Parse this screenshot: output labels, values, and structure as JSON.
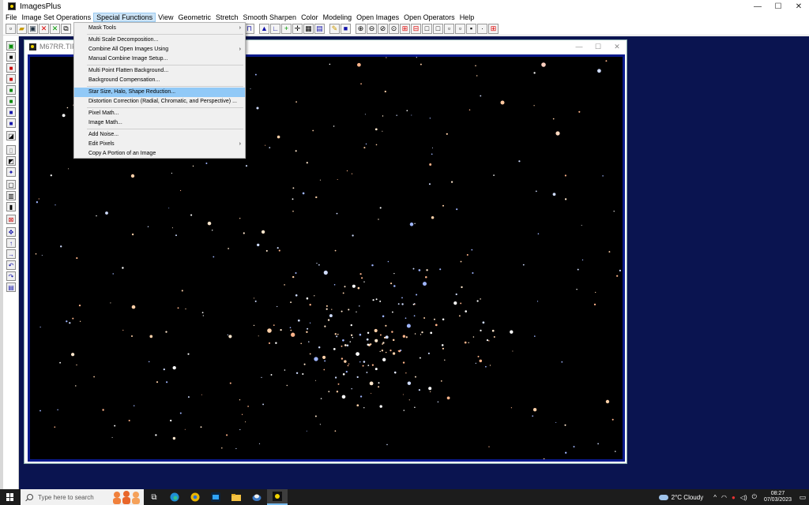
{
  "window": {
    "title": "ImagesPlus",
    "controls": {
      "minimize": "—",
      "maximize": "☐",
      "close": "✕"
    }
  },
  "menubar": {
    "items": [
      "File",
      "Image Set Operations",
      "Special Functions",
      "View",
      "Geometric",
      "Stretch",
      "Smooth Sharpen",
      "Color",
      "Modeling",
      "Open Images",
      "Open Operators",
      "Help"
    ],
    "active_index": 2
  },
  "dropdown": {
    "items": [
      {
        "label": "Mask Tools",
        "submenu": true
      },
      {
        "separator": true
      },
      {
        "label": "Multi Scale Decomposition...",
        "submenu": false
      },
      {
        "label": "Combine All Open Images Using",
        "submenu": true
      },
      {
        "label": "Manual Combine Image Setup...",
        "submenu": false
      },
      {
        "separator": true
      },
      {
        "label": "Multi Point Flatten Background...",
        "submenu": false
      },
      {
        "label": "Background Compensation...",
        "submenu": false
      },
      {
        "separator": true
      },
      {
        "label": "Star Size, Halo, Shape Reduction...",
        "submenu": false,
        "highlighted": true
      },
      {
        "label": "Distortion Correction (Radial, Chromatic, and Perspective) ...",
        "submenu": false
      },
      {
        "separator": true
      },
      {
        "label": "Pixel Math...",
        "submenu": false
      },
      {
        "label": "Image Math...",
        "submenu": false
      },
      {
        "separator": true
      },
      {
        "label": "Add Noise...",
        "submenu": false
      },
      {
        "label": "Edit Pixels",
        "submenu": true
      },
      {
        "label": "Copy A Portion of an Image",
        "submenu": false
      }
    ],
    "submenu_arrow": "›"
  },
  "image_window": {
    "title": "M67RR.TIF.tif -",
    "controls": {
      "minimize": "—",
      "maximize": "☐",
      "close": "✕"
    },
    "background": "#000000",
    "frame_color": "#0a1a8c"
  },
  "toolbar": {
    "icons": [
      "new-file-icon",
      "open-folder-icon",
      "save-icon",
      "close-red-x-icon",
      "accept-green-x-icon",
      "copy-icon"
    ],
    "right_icons": [
      "crop-icon",
      "histogram-icon",
      "levels-icon",
      "add-point-icon",
      "crosshair-icon",
      "grid-icon",
      "calculator-icon",
      "pencil-icon",
      "stop-icon",
      "zoom-in-icon",
      "zoom-out-icon",
      "zoom-fit-icon",
      "zoom-actual-icon",
      "zoom-red-plus-icon",
      "zoom-red-minus-icon",
      "frame-icon",
      "frame-small-icon",
      "frame-medium-icon",
      "frame-dotted-icon",
      "frame-tiny-icon",
      "frame-point-icon",
      "tile-icon"
    ]
  },
  "taskbar": {
    "search_placeholder": "Type here to search",
    "apps": [
      "task-view-icon",
      "edge-icon",
      "chrome-icon",
      "photoshop-icon",
      "file-explorer-icon",
      "media-icon",
      "imagesplus-icon"
    ],
    "weather": "2°C  Cloudy",
    "time": "08:27",
    "date": "07/03/2023"
  },
  "colors": {
    "workspace": "#0a1450",
    "menu_highlight": "#91c9f7",
    "active_menu": "#cce4f7"
  }
}
